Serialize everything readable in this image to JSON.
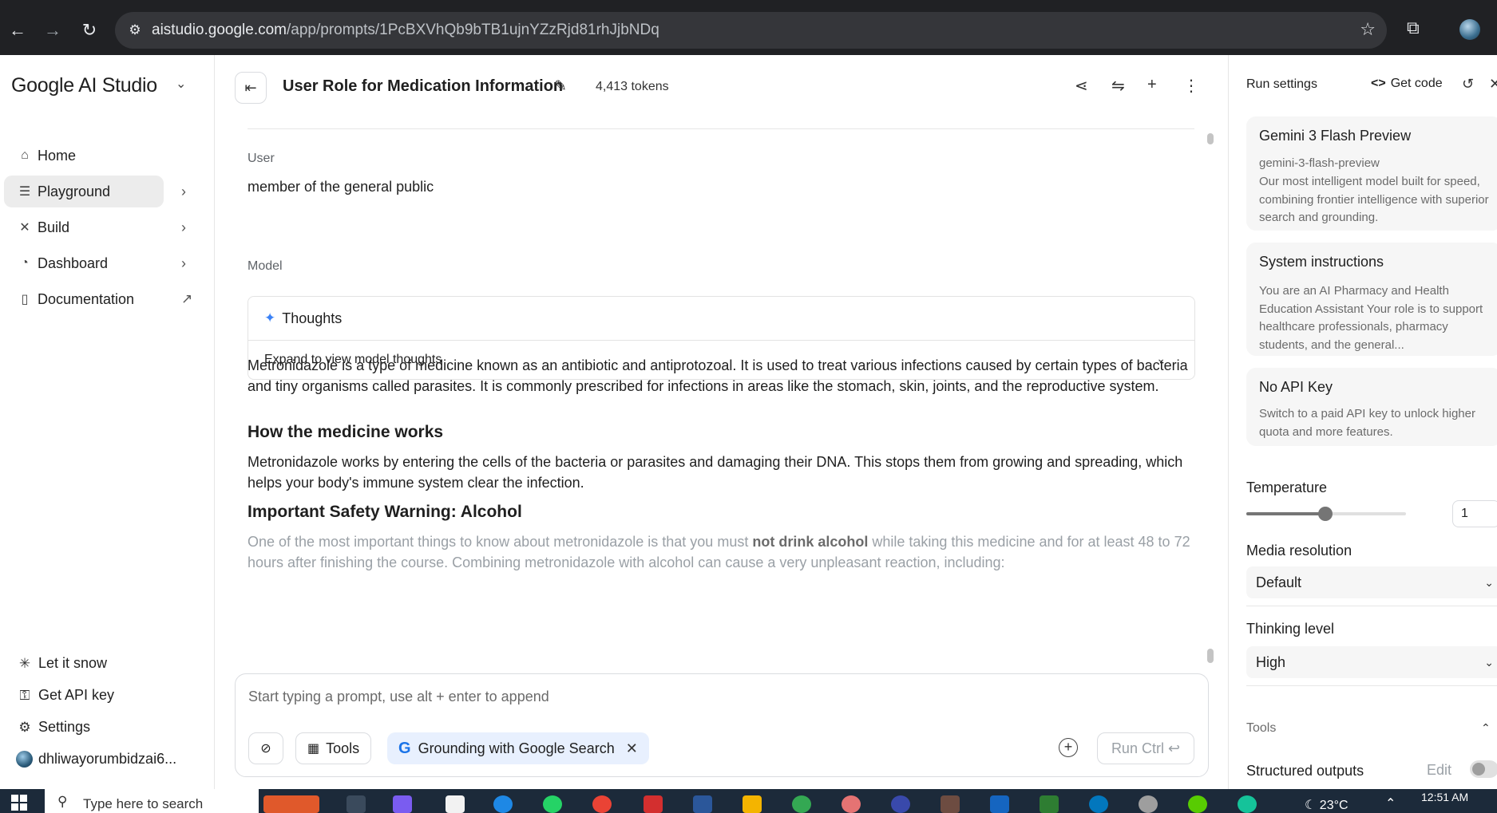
{
  "browser": {
    "url_host": "aistudio.google.com",
    "url_path": "/app/prompts/1PcBXVhQb9bTB1ujnYZzRjd81rhJjbNDq"
  },
  "sidebar": {
    "brand": "Google AI Studio",
    "items": [
      {
        "label": "Home"
      },
      {
        "label": "Playground"
      },
      {
        "label": "Build"
      },
      {
        "label": "Dashboard"
      },
      {
        "label": "Documentation"
      }
    ],
    "bottom": [
      {
        "label": "Let it snow"
      },
      {
        "label": "Get API key"
      },
      {
        "label": "Settings"
      },
      {
        "label": "dhliwayorumbidzai6..."
      }
    ]
  },
  "header": {
    "title": "User Role for Medication Information",
    "tokens": "4,413 tokens"
  },
  "chat": {
    "user_label": "User",
    "user_message": "member of the general public",
    "model_label": "Model",
    "thoughts_title": "Thoughts",
    "thoughts_expand": "Expand to view model thoughts",
    "para1": "Metronidazole is a type of medicine known as an antibiotic and antiprotozoal. It is used to treat various infections caused by certain types of bacteria and tiny organisms called parasites. It is commonly prescribed for infections in areas like the stomach, skin, joints, and the reproductive system.",
    "heading1": "How the medicine works",
    "para2": "Metronidazole works by entering the cells of the bacteria or parasites and damaging their DNA. This stops them from growing and spreading, which helps your body's immune system clear the infection.",
    "heading2": "Important Safety Warning: Alcohol",
    "para3_a": "One of the most important things to know about metronidazole is that you must ",
    "para3_bold": "not drink alcohol",
    "para3_b": " while taking this medicine and for at least 48 to 72 hours after finishing the course. Combining metronidazole with alcohol can cause a very unpleasant reaction, including:"
  },
  "composer": {
    "placeholder": "Start typing a prompt, use alt + enter to append",
    "tools_label": "Tools",
    "grounding_label": "Grounding with Google Search",
    "run_label": "Run Ctrl ↩"
  },
  "run_settings": {
    "title": "Run settings",
    "get_code": "Get code",
    "model_name": "Gemini 3 Flash Preview",
    "model_id": "gemini-3-flash-preview",
    "model_desc": "Our most intelligent model built for speed, combining frontier intelligence with superior search and grounding.",
    "sys_title": "System instructions",
    "sys_desc": "You are an AI Pharmacy and Health Education Assistant Your role is to support healthcare professionals, pharmacy students, and the general...",
    "api_title": "No API Key",
    "api_desc": "Switch to a paid API key to unlock higher quota and more features.",
    "temperature_label": "Temperature",
    "temperature_value": "1",
    "temperature_fraction": 0.5,
    "media_label": "Media resolution",
    "media_value": "Default",
    "thinking_label": "Thinking level",
    "thinking_value": "High",
    "tools_label": "Tools",
    "structured_label": "Structured outputs",
    "edit_label": "Edit"
  },
  "taskbar": {
    "search_placeholder": "Type here to search",
    "weather": "23°C",
    "time": "12:51 AM"
  }
}
